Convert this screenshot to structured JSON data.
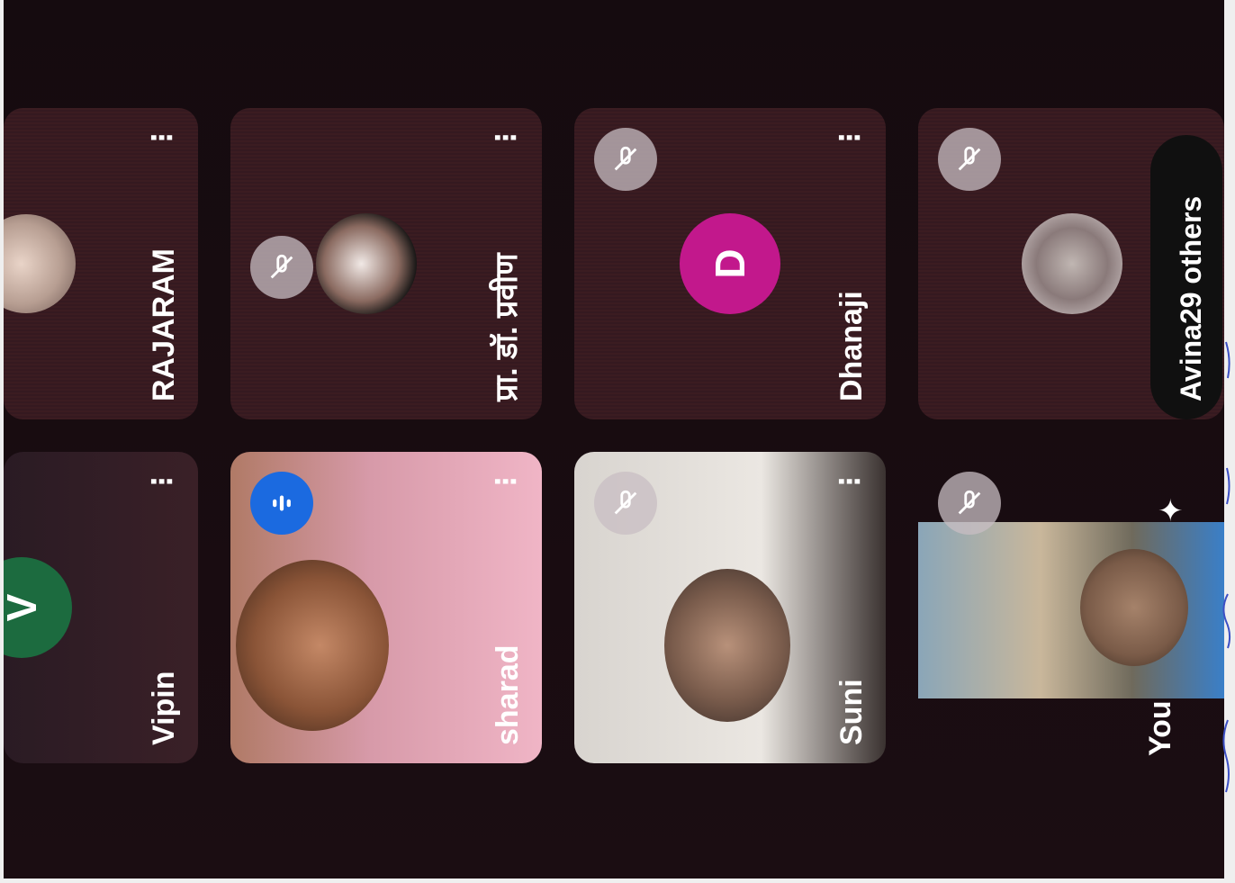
{
  "participants": [
    {
      "name": "Vipin",
      "initial": "V",
      "avatar_color": "#1c6b3f"
    },
    {
      "name": "RAJARAM"
    },
    {
      "name": "sharad"
    },
    {
      "name": "प्रा. डॉ. प्रवीण"
    },
    {
      "name": "Suni"
    },
    {
      "name": "Dhanaji",
      "initial": "D",
      "avatar_color": "#c2188c"
    },
    {
      "name": "You"
    },
    {
      "name": "Avina",
      "others_label": "29 others"
    }
  ],
  "more_options_glyph": "⋮",
  "colors": {
    "tile_background": "#3a1a20",
    "muted_badge": "#c9bfc4",
    "speaking_badge": "#1b6ae0"
  },
  "icons": [
    "mic-off-icon",
    "audio-wave-icon",
    "more-vert-icon",
    "sparkle-icon"
  ]
}
